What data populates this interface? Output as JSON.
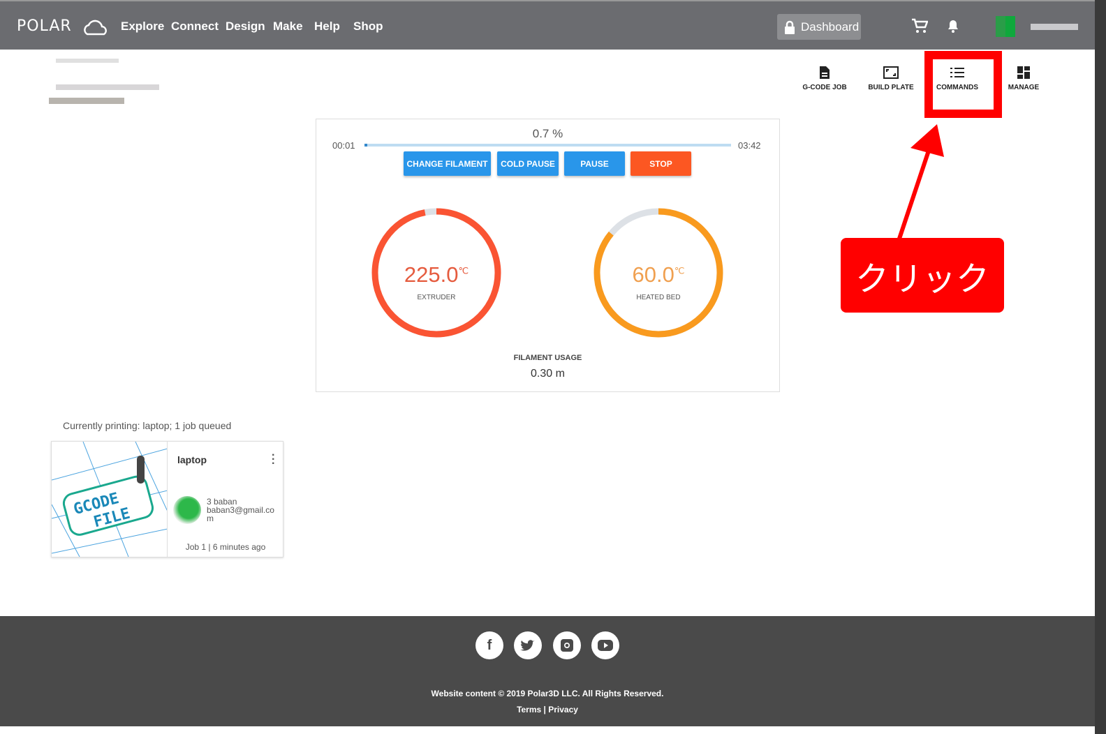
{
  "nav": {
    "logo": "POLAR",
    "links": [
      "Explore",
      "Connect",
      "Design",
      "Make",
      "Help",
      "Shop"
    ],
    "dashboard": "Dashboard"
  },
  "toolbar": [
    {
      "label": "G-CODE JOB",
      "icon": "file-icon"
    },
    {
      "label": "BUILD PLATE",
      "icon": "build-plate-icon"
    },
    {
      "label": "COMMANDS",
      "icon": "list-icon"
    },
    {
      "label": "MANAGE",
      "icon": "dashboard-icon"
    }
  ],
  "print": {
    "progress_label": "0.7 %",
    "progress": 0.007,
    "elapsed": "00:01",
    "remaining": "03:42",
    "buttons": [
      "CHANGE FILAMENT",
      "COLD PAUSE",
      "PAUSE",
      "STOP"
    ],
    "extruder": {
      "value": "225.0",
      "unit": "℃",
      "label": "EXTRUDER",
      "fill": 0.97,
      "color": "#fa5433"
    },
    "bed": {
      "value": "60.0",
      "unit": "℃",
      "label": "HEATED BED",
      "fill": 0.86,
      "color": "#f99a1e"
    },
    "filament_label": "FILAMENT USAGE",
    "filament_value": "0.30 m"
  },
  "queue": {
    "status": "Currently printing: laptop; 1 job queued",
    "job": {
      "name": "laptop",
      "user": "3 baban",
      "email": "baban3@gmail.com",
      "meta": "Job 1 | 6 minutes ago",
      "thumb_text": [
        "GCODE",
        "FILE"
      ]
    }
  },
  "annotation": {
    "label": "クリック",
    "color": "#ff0000"
  },
  "footer": {
    "copyright": "Website content © 2019 Polar3D LLC. All Rights Reserved.",
    "terms": "Terms",
    "sep": " | ",
    "privacy": "Privacy"
  }
}
